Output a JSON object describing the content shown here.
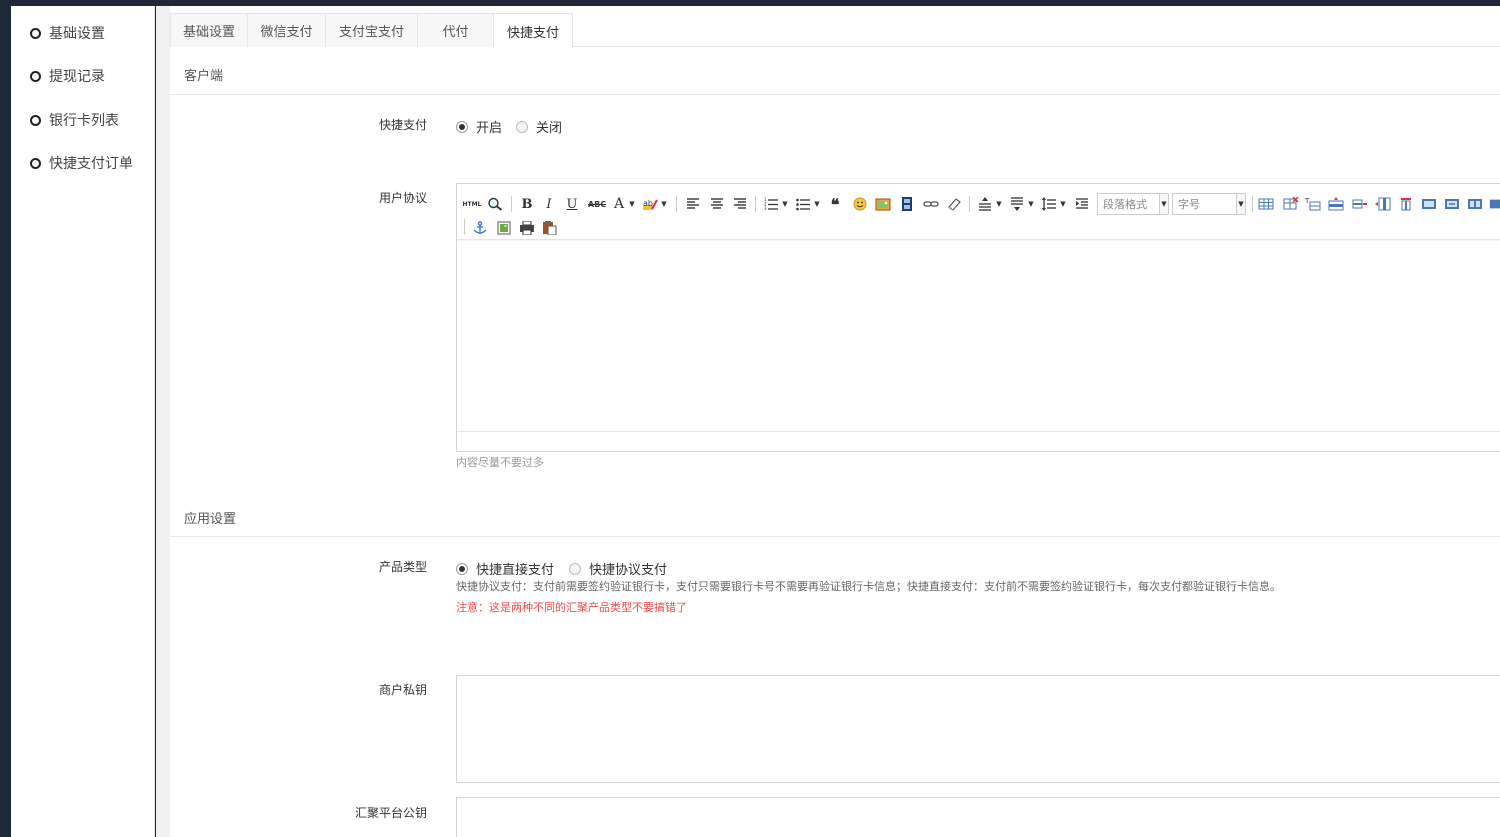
{
  "sidebar": {
    "items": [
      {
        "label": "基础设置"
      },
      {
        "label": "提现记录"
      },
      {
        "label": "银行卡列表"
      },
      {
        "label": "快捷支付订单"
      }
    ]
  },
  "tabs": [
    {
      "label": "基础设置"
    },
    {
      "label": "微信支付"
    },
    {
      "label": "支付宝支付"
    },
    {
      "label": "代付"
    },
    {
      "label": "快捷支付",
      "active": true
    }
  ],
  "sections": {
    "client": "客户端",
    "app": "应用设置"
  },
  "fields": {
    "quickpay": {
      "label": "快捷支付",
      "options": [
        "开启",
        "关闭"
      ],
      "selected": "开启"
    },
    "agreement": {
      "label": "用户协议",
      "help": "内容尽量不要过多",
      "toolbar": {
        "html_label": "HTML",
        "bold": "B",
        "italic": "I",
        "underline": "U",
        "strike": "ABC",
        "fontcolor": "A",
        "paragraph_placeholder": "段落格式",
        "fontsize_placeholder": "字号"
      }
    },
    "product_type": {
      "label": "产品类型",
      "options": [
        "快捷直接支付",
        "快捷协议支付"
      ],
      "selected": "快捷直接支付",
      "help": "快捷协议支付：支付前需要签约验证银行卡，支付只需要银行卡号不需要再验证银行卡信息；快捷直接支付：支付前不需要签约验证银行卡，每次支付都验证银行卡信息。",
      "warning": "注意：这是两种不同的汇聚产品类型不要搞错了"
    },
    "merchant_key": {
      "label": "商户私钥",
      "value": ""
    },
    "platform_key": {
      "label": "汇聚平台公钥",
      "value": ""
    }
  },
  "colors": {
    "frame": "#1f2836",
    "warning": "#f04b4b",
    "border": "#d4d4d4"
  }
}
